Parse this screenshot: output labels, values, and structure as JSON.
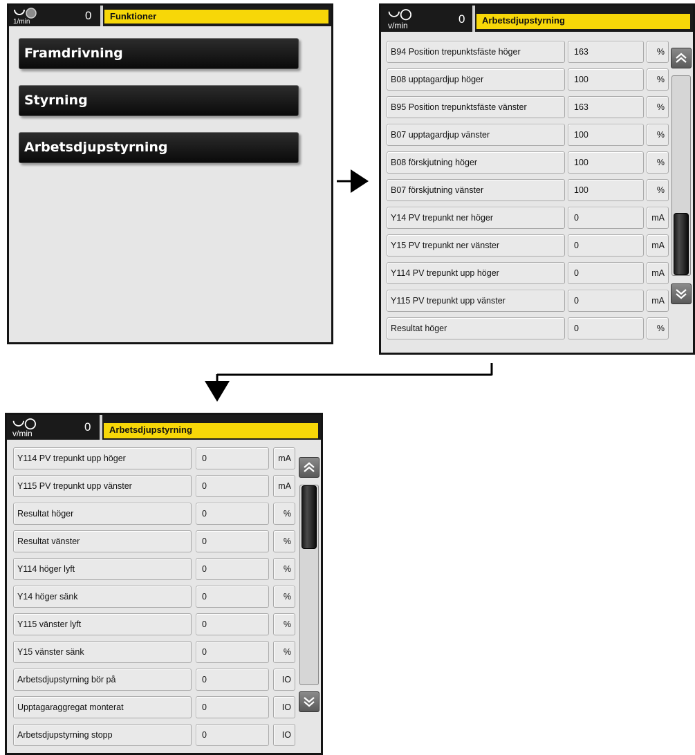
{
  "screen1": {
    "speed_value": "0",
    "unit": "1/min",
    "title": "Funktioner",
    "menu": [
      {
        "label": "Framdrivning"
      },
      {
        "label": "Styrning"
      },
      {
        "label": "Arbetsdjupstyrning"
      }
    ]
  },
  "screen2": {
    "speed_value": "0",
    "unit": "v/min",
    "title": "Arbetsdjupstyrning",
    "rows": [
      {
        "label": "B94 Position trepunktsfäste höger",
        "value": "163",
        "unit": "%"
      },
      {
        "label": "B08 upptagardjup höger",
        "value": "100",
        "unit": "%"
      },
      {
        "label": "B95 Position trepunktsfäste vänster",
        "value": "163",
        "unit": "%"
      },
      {
        "label": "B07 upptagardjup vänster",
        "value": "100",
        "unit": "%"
      },
      {
        "label": "B08 förskjutning höger",
        "value": "100",
        "unit": "%"
      },
      {
        "label": "B07 förskjutning vänster",
        "value": "100",
        "unit": "%"
      },
      {
        "label": "Y14 PV trepunkt ner höger",
        "value": "0",
        "unit": "mA"
      },
      {
        "label": "Y15 PV trepunkt ner vänster",
        "value": "0",
        "unit": "mA"
      },
      {
        "label": "Y114 PV trepunkt upp höger",
        "value": "0",
        "unit": "mA"
      },
      {
        "label": "Y115 PV trepunkt upp vänster",
        "value": "0",
        "unit": "mA"
      },
      {
        "label": "Resultat höger",
        "value": "0",
        "unit": "%"
      }
    ],
    "scroll_position": 0.62
  },
  "screen3": {
    "speed_value": "0",
    "unit": "v/min",
    "title": "Arbetsdjupstyrning",
    "rows": [
      {
        "label": "Y114 PV trepunkt upp höger",
        "value": "0",
        "unit": "mA"
      },
      {
        "label": "Y115 PV trepunkt upp vänster",
        "value": "0",
        "unit": "mA"
      },
      {
        "label": "Resultat höger",
        "value": "0",
        "unit": "%"
      },
      {
        "label": "Resultat vänster",
        "value": "0",
        "unit": "%"
      },
      {
        "label": "Y114 höger lyft",
        "value": "0",
        "unit": "%"
      },
      {
        "label": "Y14 höger sänk",
        "value": "0",
        "unit": "%"
      },
      {
        "label": "Y115 vänster lyft",
        "value": "0",
        "unit": "%"
      },
      {
        "label": "Y15 vänster sänk",
        "value": "0",
        "unit": "%"
      },
      {
        "label": "Arbetsdjupstyrning bör på",
        "value": "0",
        "unit": "IO"
      },
      {
        "label": "Upptagaraggregat monterat",
        "value": "0",
        "unit": "IO"
      },
      {
        "label": "Arbetsdjupstyrning stopp",
        "value": "0",
        "unit": "IO"
      }
    ],
    "scroll_position": 0.0
  }
}
